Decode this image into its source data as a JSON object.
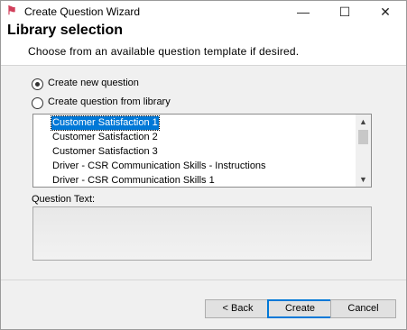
{
  "window": {
    "title": "Create Question Wizard",
    "minimize_label": "—",
    "maximize_label": "☐",
    "close_label": "✕"
  },
  "header": {
    "heading": "Library selection",
    "subheading": "Choose from an available question template if desired."
  },
  "options": {
    "create_new": "Create new question",
    "create_from_library": "Create question from library",
    "selected": "create_new"
  },
  "library": {
    "items": [
      "Customer Satisfaction 1",
      "Customer Satisfaction 2",
      "Customer Satisfaction 3",
      "Driver - CSR Communication Skills - Instructions",
      "Driver - CSR Communication Skills 1"
    ],
    "selected_index": 0
  },
  "question_text": {
    "label": "Question Text:",
    "value": ""
  },
  "buttons": {
    "back": "< Back",
    "create": "Create",
    "cancel": "Cancel"
  }
}
